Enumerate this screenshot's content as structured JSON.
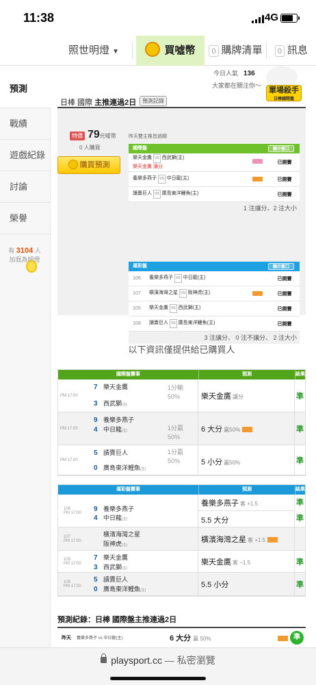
{
  "status_bar": {
    "time": "11:38",
    "network": "4G"
  },
  "nav": {
    "lamp": "照世明燈",
    "buy": "買噓幣",
    "cart_count": "0",
    "cart": "購牌清單",
    "msg_count": "0",
    "msg": "訊息"
  },
  "sidebar": {
    "items": [
      "預測",
      "戰績",
      "遊戲紀錄",
      "討論",
      "榮譽"
    ],
    "online_prefix": "有",
    "online_count": "3104",
    "online_suffix": "人",
    "online_note": "加我為明燈"
  },
  "info": {
    "popularity_label": "今日人氣",
    "popularity": "136",
    "watch_text": "大家都在關注你～"
  },
  "header": {
    "title_prefix": "日棒 國際 ",
    "title_bold": "主推連過2日",
    "tag": "預測記錄",
    "badge": "單場殺手",
    "badge_sub": "日棒國際盤"
  },
  "price": {
    "tag": "特價",
    "amount": "79",
    "unit": "元噓幣",
    "buyers": "0 人購買",
    "buy_button": "購買預測"
  },
  "yesterday_note": "昨天雙主推皆過關",
  "intl_table": {
    "title": "國際盤",
    "show_button": "顯示盤口",
    "rows": [
      {
        "line1": "樂天金鷹",
        "vs": "VS",
        "line1b": "西武獅(主)",
        "line2": "樂天金鷹  讓分",
        "status": "已開賽"
      },
      {
        "line1": "養樂多燕子",
        "vs": "VS",
        "line1b": "中日龍(主)",
        "line2": "",
        "status": "已開賽"
      },
      {
        "line1": "讀賣巨人",
        "vs": "VS",
        "line1b": "廣島東洋鯉魚(主)",
        "line2": "",
        "status": "已開賽"
      }
    ],
    "summary": "1 注讓分、2 注大小"
  },
  "lottery_table": {
    "title": "運彩盤",
    "show_button": "顯示盤口",
    "rows": [
      {
        "num": "106",
        "a": "養樂多燕子",
        "vs": "VS",
        "b": "中日龍(主)",
        "status": "已開賽"
      },
      {
        "num": "107",
        "a": "橫濱海灣之星",
        "vs": "VS",
        "b": "阪神虎(主)",
        "status": "已開賽"
      },
      {
        "num": "105",
        "a": "樂天金鷹",
        "vs": "VS",
        "b": "西武獅(主)",
        "status": "已開賽"
      },
      {
        "num": "108",
        "a": "讀賣巨人",
        "vs": "VS",
        "b": "廣島東洋鯉魚(主)",
        "status": "已開賽"
      }
    ],
    "summary": "3 注讓分、 0 注不讓分、 2 注大小"
  },
  "notice": "以下資訊僅提供給已購買人",
  "intl_results": {
    "headers": [
      "國際盤賽事",
      "預測",
      "結果"
    ],
    "rows": [
      {
        "time": "PM 17:00",
        "score_a": "7",
        "team_a": "樂天金鷹",
        "score_b": "3",
        "team_b": "西武獅",
        "home": "(主)",
        "odds": "1分輸\n50%",
        "pred": "樂天金鷹",
        "pred_sub": "讓分",
        "result": "準"
      },
      {
        "time": "PM 17:00",
        "score_a": "9",
        "team_a": "養樂多燕子",
        "score_b": "4",
        "team_b": "中日龍",
        "home": "(主)",
        "odds": "1分贏\n50%",
        "pred": "6 大分",
        "pred_sub": "贏50%",
        "result": "準"
      },
      {
        "time": "PM 17:00",
        "score_a": "5",
        "team_a": "讀賣巨人",
        "score_b": "0",
        "team_b": "廣島東洋鯉魚",
        "home": "(主)",
        "odds": "1分贏\n50%",
        "pred": "5 小分",
        "pred_sub": "贏50%",
        "result": "準"
      }
    ]
  },
  "lottery_results": {
    "headers": [
      "運彩盤賽事",
      "預測",
      "結果"
    ],
    "rows": [
      {
        "num": "106",
        "time": "PM 17:00",
        "score_a": "9",
        "team_a": "養樂多燕子",
        "score_b": "4",
        "team_b": "中日龍",
        "home": "(主)",
        "pred1": "養樂多燕子",
        "pred1_sub": "客 +1.5",
        "result1": "準",
        "pred2": "5.5 大分",
        "result2": "準"
      },
      {
        "num": "107",
        "time": "PM 17:00",
        "score_a": "",
        "team_a": "橫濱海灣之星",
        "score_b": "",
        "team_b": "阪神虎",
        "home": "(主)",
        "pred1": "橫濱海灣之星",
        "pred1_sub": "客 +1.5",
        "result1": ""
      },
      {
        "num": "105",
        "time": "PM 17:00",
        "score_a": "7",
        "team_a": "樂天金鷹",
        "score_b": "3",
        "team_b": "西武獅",
        "home": "(主)",
        "pred1": "樂天金鷹",
        "pred1_sub": "客 −1.5",
        "result1": "準"
      },
      {
        "num": "108",
        "time": "PM 17:00",
        "score_a": "5",
        "team_a": "讀賣巨人",
        "score_b": "0",
        "team_b": "廣島東洋鯉魚",
        "home": "(主)",
        "pred1": "5.5 小分",
        "pred1_sub": "",
        "result1": "準"
      }
    ]
  },
  "record": {
    "title": "預測紀錄：日棒 國際盤主推連過2日",
    "day": "昨天",
    "match_a": "養樂多燕子",
    "vs": "vs",
    "match_b": "中日龍",
    "home": "(主)",
    "pred": "6 大分",
    "pred_sub": "贏 50%",
    "result": "準"
  },
  "browser": {
    "url": "playsport.cc",
    "mode": " — 私密瀏覽"
  },
  "colors": {
    "green_header": "#6ec12b",
    "blue_header": "#1ea1e0",
    "win": "#2c9a2c",
    "buy_active": "#dff3c2"
  }
}
